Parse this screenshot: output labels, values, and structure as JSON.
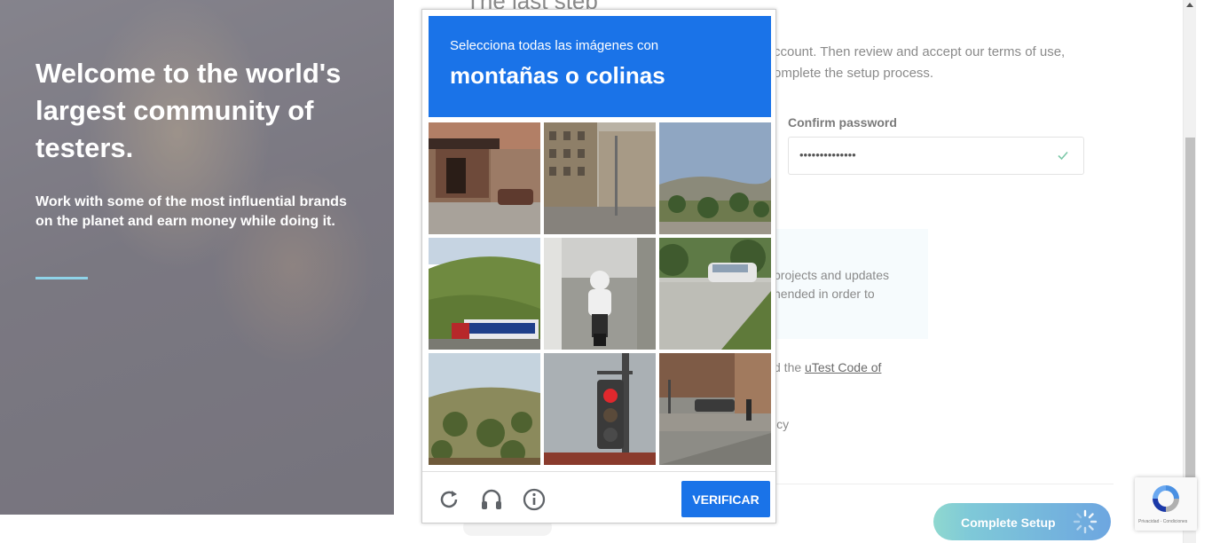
{
  "hero": {
    "title": "Welcome to the world's largest community of testers.",
    "subtitle": "Work with some of the most influential brands on the planet and earn money while doing it."
  },
  "form": {
    "heading": "The last step",
    "intro": "ccount. Then review and accept our terms of use, omplete the setup process.",
    "confirm_password_label": "Confirm password",
    "confirm_password_value": "••••••••••••••",
    "info_text": "projects and updates hended in order to",
    "coc_prefix": "d the ",
    "coc_link": "uTest Code of",
    "privacy_text": "icy",
    "complete_button": "Complete Setup"
  },
  "captcha": {
    "instruction": "Selecciona todas las imágenes con",
    "target": "montañas o colinas",
    "verify_button": "VERIFICAR",
    "tiles": [
      {
        "name": "tile-1-storefront"
      },
      {
        "name": "tile-2-city-buildings"
      },
      {
        "name": "tile-3-hillside-view"
      },
      {
        "name": "tile-4-green-hill-truck"
      },
      {
        "name": "tile-5-motorcycle-rider"
      },
      {
        "name": "tile-6-parked-car"
      },
      {
        "name": "tile-7-brush-hill"
      },
      {
        "name": "tile-8-traffic-light"
      },
      {
        "name": "tile-9-street-corner"
      }
    ],
    "tools": [
      "reload-icon",
      "audio-icon",
      "info-icon"
    ]
  },
  "recaptcha_badge": {
    "text": "Privacidad - Condiciones"
  },
  "colors": {
    "captcha_blue": "#1a73e8",
    "accent_teal": "#8fd3e8"
  }
}
